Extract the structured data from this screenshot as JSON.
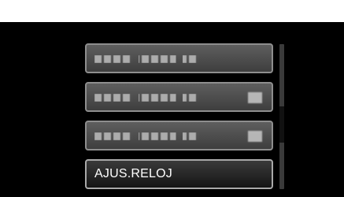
{
  "menu": {
    "items": [
      {
        "label": "▪▪▪ ▪▪▪▪ ▪▪",
        "value": ""
      },
      {
        "label": "▪▪▪ ▪▪▪▪ ▪▪",
        "value": "▪▪"
      },
      {
        "label": "▪▪▪ ▪▪▪▪ ▪▪",
        "value": "▪▪"
      },
      {
        "label": "AJUS.RELOJ",
        "value": ""
      }
    ],
    "selected_index": 3
  },
  "scrollbar": {
    "position_fraction": 0.72,
    "visible_fraction": 0.25
  },
  "colors": {
    "background": "#000000",
    "item": "#4a4a4a",
    "item_border": "#8e8e8e",
    "text": "#ffffff"
  }
}
